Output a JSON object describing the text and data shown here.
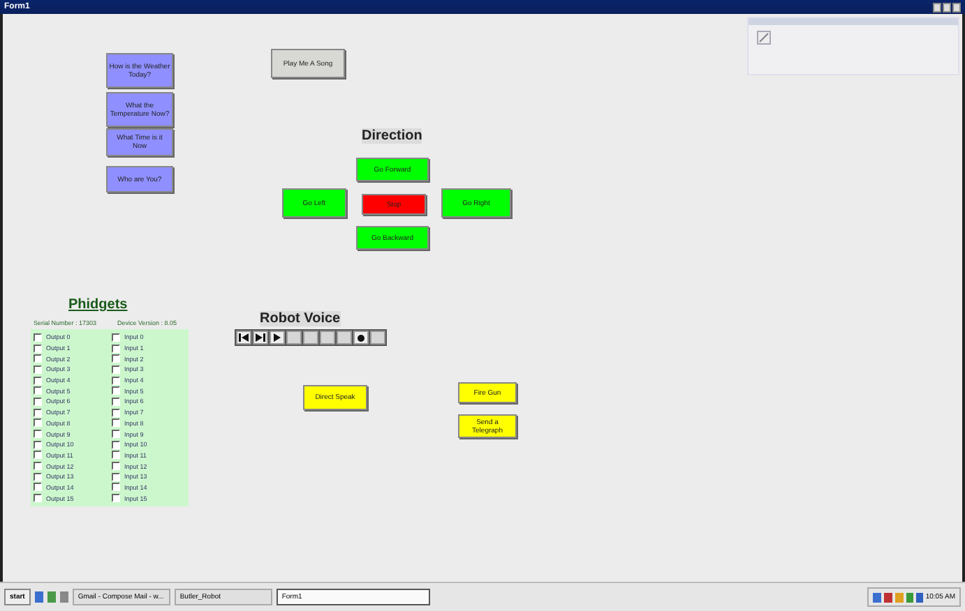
{
  "window": {
    "title": "Form1"
  },
  "question_buttons": [
    {
      "label": "How is the Weather Today?"
    },
    {
      "label": "What the Temperature Now?"
    },
    {
      "label": "What Time is it Now"
    },
    {
      "label": "Who are You?"
    }
  ],
  "song_button": {
    "label": "Play Me A Song"
  },
  "direction": {
    "title": "Direction",
    "buttons": [
      {
        "label": "Go Forward",
        "kind": "forward"
      },
      {
        "label": "Go Left",
        "kind": "left"
      },
      {
        "label": "Stop",
        "kind": "stop"
      },
      {
        "label": "Go Right",
        "kind": "right"
      },
      {
        "label": "Go Backward",
        "kind": "backward"
      }
    ]
  },
  "phidgets": {
    "title": "Phidgets",
    "serial": "Serial Number : 17303",
    "version": "Device Version : 8.05",
    "outputs": [
      {
        "label": "Output 0",
        "checked": false
      },
      {
        "label": "Output 1",
        "checked": false
      },
      {
        "label": "Output 2",
        "checked": false
      },
      {
        "label": "Output 3",
        "checked": false
      },
      {
        "label": "Output 4",
        "checked": false
      },
      {
        "label": "Output 5",
        "checked": false
      },
      {
        "label": "Output 6",
        "checked": false
      },
      {
        "label": "Output 7",
        "checked": false
      },
      {
        "label": "Output 8",
        "checked": false
      },
      {
        "label": "Output 9",
        "checked": false
      },
      {
        "label": "Output 10",
        "checked": false
      },
      {
        "label": "Output 11",
        "checked": false
      },
      {
        "label": "Output 12",
        "checked": false
      },
      {
        "label": "Output 13",
        "checked": false
      },
      {
        "label": "Output 14",
        "checked": false
      },
      {
        "label": "Output 15",
        "checked": false
      }
    ],
    "inputs": [
      {
        "label": "Input 0",
        "checked": false
      },
      {
        "label": "Input 1",
        "checked": false
      },
      {
        "label": "Input 2",
        "checked": false
      },
      {
        "label": "Input 3",
        "checked": false
      },
      {
        "label": "Input 4",
        "checked": false
      },
      {
        "label": "Input 5",
        "checked": false
      },
      {
        "label": "Input 6",
        "checked": false
      },
      {
        "label": "Input 7",
        "checked": false
      },
      {
        "label": "Input 8",
        "checked": false
      },
      {
        "label": "Input 9",
        "checked": false
      },
      {
        "label": "Input 10",
        "checked": false
      },
      {
        "label": "Input 11",
        "checked": false
      },
      {
        "label": "Input 12",
        "checked": false
      },
      {
        "label": "Input 13",
        "checked": false
      },
      {
        "label": "Input 14",
        "checked": false
      },
      {
        "label": "Input 15",
        "checked": false
      }
    ]
  },
  "robot_voice": {
    "title": "Robot Voice",
    "media_buttons": [
      {
        "kind": "previous",
        "disabled": false
      },
      {
        "kind": "step",
        "disabled": false
      },
      {
        "kind": "play",
        "disabled": false
      },
      {
        "kind": "blank",
        "disabled": true
      },
      {
        "kind": "blank",
        "disabled": true
      },
      {
        "kind": "blank",
        "disabled": true
      },
      {
        "kind": "blank",
        "disabled": true
      },
      {
        "kind": "record",
        "disabled": false
      },
      {
        "kind": "blank",
        "disabled": true
      }
    ]
  },
  "action_buttons": [
    {
      "label": "Direct Speak",
      "kind": "speak"
    },
    {
      "label": "Fire Gun",
      "kind": "gun"
    },
    {
      "label": "Send a Telegraph",
      "kind": "telegraph"
    }
  ],
  "taskbar": {
    "start": "start",
    "tasks": [
      {
        "label": "Gmail - Compose Mail - w...",
        "selected": false
      },
      {
        "label": "Butler_Robot",
        "selected": false
      },
      {
        "label": "Form1",
        "selected": true
      }
    ],
    "clock": "10:05 AM"
  }
}
